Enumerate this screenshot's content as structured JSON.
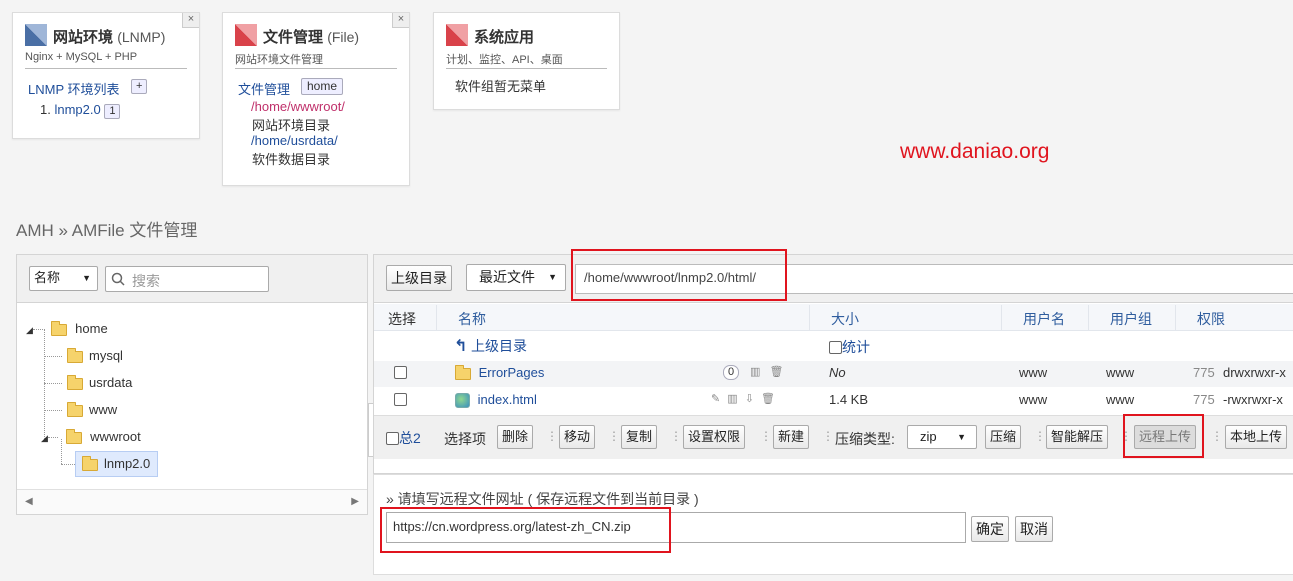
{
  "cards": {
    "lnmp": {
      "title": "网站环境",
      "title_en": "(LNMP)",
      "subtitle": "Nginx + MySQL + PHP",
      "list_label": "LNMP 环境列表",
      "add_label": "+",
      "item_index": "1.",
      "item_name": "lnmp2.0",
      "item_count": "1",
      "close": "×"
    },
    "file": {
      "title": "文件管理",
      "title_en": "(File)",
      "subtitle": "网站环境文件管理",
      "label": "文件管理",
      "tag": "home",
      "path1": "/home/wwwroot/",
      "path1_desc": "网站环境目录",
      "path2": "/home/usrdata/",
      "path2_desc": "软件数据目录",
      "close": "×"
    },
    "sys": {
      "title": "系统应用",
      "subtitle": "计划、监控、API、桌面",
      "empty": "软件组暂无菜单"
    }
  },
  "watermark": "www.daniao.org",
  "breadcrumb": "AMH » AMFile 文件管理",
  "tree": {
    "sort_label": "名称",
    "search_placeholder": "搜索",
    "items": [
      "home",
      "mysql",
      "usrdata",
      "www",
      "wwwroot",
      "lnmp2.0"
    ],
    "collapse_label": "<"
  },
  "toolbar": {
    "up_label": "上级目录",
    "recent_label": "最近文件",
    "path": "/home/wwwroot/lnmp2.0/html/"
  },
  "table": {
    "headers": [
      "选择",
      "名称",
      "大小",
      "用户名",
      "用户组",
      "权限"
    ],
    "parent_label": "上级目录",
    "stats_label": "统计",
    "rows": [
      {
        "name": "ErrorPages",
        "badge": "0",
        "size": "No",
        "user": "www",
        "group": "www",
        "perm_num": "775",
        "perm": "drwxrwxr-x"
      },
      {
        "name": "index.html",
        "size": "1.4 KB",
        "user": "www",
        "group": "www",
        "perm_num": "775",
        "perm": "-rwxrwxr-x"
      }
    ]
  },
  "actions": {
    "total": "总2",
    "select_label": "选择项",
    "delete": "删除",
    "move": "移动",
    "copy": "复制",
    "perm": "设置权限",
    "new": "新建",
    "compress_type_label": "压缩类型:",
    "compress_type": "zip",
    "compress": "压缩",
    "smart_unzip": "智能解压",
    "remote_upload": "远程上传",
    "local_upload": "本地上传"
  },
  "remote": {
    "hint": "» 请填写远程文件网址 ( 保存远程文件到当前目录 )",
    "url": "https://cn.wordpress.org/latest-zh_CN.zip",
    "confirm": "确定",
    "cancel": "取消"
  },
  "colors": {
    "accent_red": "#e0141e",
    "link_blue": "#1f4e9a",
    "pink": "#c0306b"
  }
}
